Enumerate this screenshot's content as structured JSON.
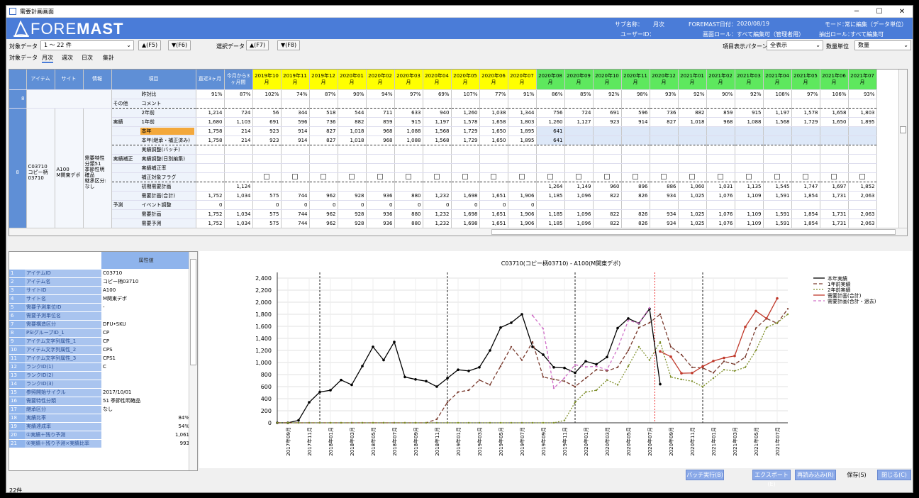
{
  "window": {
    "title": "需要計画画面",
    "min": "─",
    "max": "☐",
    "close": "✕"
  },
  "header": {
    "logo": "FOREMAST",
    "sub_label": "サブ名称：",
    "sub_value": "月次",
    "date_label": "FOREMAST日付：",
    "date_value": "2020/08/19",
    "mode_label": "モード：",
    "mode_value": "常に編集（データ単位）",
    "user_label": "ユーザーID：",
    "role_label": "画面ロール：",
    "role_value": "すべて編集可（管理者用）",
    "extract_label": "抽出ロール：",
    "extract_value": "すべて編集可"
  },
  "toolbar": {
    "target_label": "対象データ",
    "target_value": "1 〜 22 件",
    "up1": "▲(F5)",
    "down1": "▼(F6)",
    "select_label": "選択データ",
    "up2": "▲(F7)",
    "down2": "▼(F8)",
    "pattern_label": "項目表示パターン",
    "pattern_value": "全表示",
    "unit_label": "数量単位",
    "unit_value": "数量"
  },
  "tabs": {
    "lead": "対象データ",
    "items": [
      "月次",
      "週次",
      "日次",
      "集計"
    ]
  },
  "grid": {
    "headers": {
      "item": "アイテム",
      "site": "サイト",
      "info": "情報",
      "field": "項目",
      "recent3": "直近3ヶ月",
      "next3": "今月から3ヶ月間"
    },
    "months": [
      "2019年10月",
      "2019年11月",
      "2019年12月",
      "2020年01月",
      "2020年02月",
      "2020年03月",
      "2020年04月",
      "2020年05月",
      "2020年06月",
      "2020年07月",
      "2020年08月",
      "2020年09月",
      "2020年10月",
      "2020年11月",
      "2020年12月",
      "2021年01月",
      "2021年02月",
      "2021年03月",
      "2021年04月",
      "2021年05月",
      "2021年06月",
      "2021年07月"
    ],
    "row_num": "8",
    "item": "C03710\nコピー柄\n03710",
    "site": "A100\nM関東デポ",
    "info": "需要特性\n分類51\n季節性明\n確品\n継承区分:\nなし",
    "groups": {
      "other": "その他",
      "actual": "実績",
      "correction": "実績補正",
      "forecast": "予測"
    },
    "rows": [
      {
        "label": "昨対比",
        "r3": "91%",
        "n3": "87%",
        "v": [
          "102%",
          "74%",
          "87%",
          "90%",
          "94%",
          "97%",
          "69%",
          "107%",
          "77%",
          "91%",
          "86%",
          "85%",
          "92%",
          "98%",
          "93%",
          "92%",
          "90%",
          "92%",
          "108%",
          "97%",
          "106%",
          "93%"
        ]
      },
      {
        "label": "コメント",
        "r3": "",
        "n3": "",
        "v": [
          "",
          "",
          "",
          "",
          "",
          "",
          "",
          "",
          "",
          "",
          "",
          "",
          "",
          "",
          "",
          "",
          "",
          "",
          "",
          "",
          "",
          ""
        ]
      },
      {
        "label": "2年前",
        "r3": "1,214",
        "n3": "724",
        "v": [
          "56",
          "344",
          "518",
          "544",
          "711",
          "633",
          "940",
          "1,260",
          "1,038",
          "1,344",
          "756",
          "724",
          "691",
          "596",
          "736",
          "882",
          "859",
          "915",
          "1,197",
          "1,578",
          "1,658",
          "1,803"
        ]
      },
      {
        "label": "1年前",
        "r3": "1,680",
        "n3": "1,103",
        "v": [
          "691",
          "596",
          "736",
          "882",
          "859",
          "915",
          "1,197",
          "1,578",
          "1,658",
          "1,803",
          "1,260",
          "1,127",
          "923",
          "914",
          "827",
          "1,018",
          "968",
          "1,088",
          "1,568",
          "1,729",
          "1,650",
          "1,895"
        ]
      },
      {
        "label": "本年",
        "r3": "1,758",
        "n3": "214",
        "v": [
          "923",
          "914",
          "827",
          "1,018",
          "968",
          "1,088",
          "1,568",
          "1,729",
          "1,650",
          "1,895",
          "641",
          "",
          "",
          "",
          "",
          "",
          "",
          "",
          "",
          "",
          "",
          ""
        ]
      },
      {
        "label": "本年(継承・補正済み)",
        "r3": "1,758",
        "n3": "214",
        "v": [
          "923",
          "914",
          "827",
          "1,018",
          "968",
          "1,088",
          "1,568",
          "1,729",
          "1,650",
          "1,895",
          "641",
          "",
          "",
          "",
          "",
          "",
          "",
          "",
          "",
          "",
          "",
          ""
        ]
      },
      {
        "label": "実績調整(バッチ)",
        "r3": "",
        "n3": "",
        "v": [
          "",
          "",
          "",
          "",
          "",
          "",
          "",
          "",
          "",
          "",
          "",
          "",
          "",
          "",
          "",
          "",
          "",
          "",
          "",
          "",
          "",
          ""
        ]
      },
      {
        "label": "実績調整(日別編集)",
        "r3": "",
        "n3": "",
        "v": [
          "",
          "",
          "",
          "",
          "",
          "",
          "",
          "",
          "",
          "",
          "",
          "",
          "",
          "",
          "",
          "",
          "",
          "",
          "",
          "",
          "",
          ""
        ]
      },
      {
        "label": "実績補正率",
        "r3": "",
        "n3": "",
        "v": [
          "",
          "",
          "",
          "",
          "",
          "",
          "",
          "",
          "",
          "",
          "",
          "",
          "",
          "",
          "",
          "",
          "",
          "",
          "",
          "",
          "",
          ""
        ]
      },
      {
        "label": "補正対象フラグ",
        "r3": "",
        "n3": "",
        "v": [
          "☐",
          "☐",
          "☐",
          "☐",
          "☐",
          "☐",
          "☐",
          "☐",
          "☐",
          "☐",
          "☐",
          "☐",
          "☐",
          "☐",
          "☐",
          "☐",
          "☐",
          "☐",
          "☐",
          "☐",
          "☐",
          "☐"
        ]
      },
      {
        "label": "初期需要計画",
        "r3": "",
        "n3": "1,124",
        "v": [
          "",
          "",
          "",
          "",
          "",
          "",
          "",
          "",
          "",
          "",
          "1,264",
          "1,149",
          "960",
          "896",
          "886",
          "1,060",
          "1,031",
          "1,135",
          "1,545",
          "1,747",
          "1,697",
          "1,852"
        ]
      },
      {
        "label": "需要計画(合計)",
        "r3": "1,752",
        "n3": "1,034",
        "v": [
          "575",
          "744",
          "962",
          "928",
          "936",
          "880",
          "1,232",
          "1,698",
          "1,651",
          "1,906",
          "1,185",
          "1,096",
          "822",
          "826",
          "934",
          "1,025",
          "1,076",
          "1,109",
          "1,591",
          "1,854",
          "1,731",
          "2,063"
        ]
      },
      {
        "label": "イベント調整",
        "r3": "0",
        "n3": "",
        "v": [
          "0",
          "0",
          "0",
          "0",
          "0",
          "0",
          "0",
          "0",
          "0",
          "0",
          "",
          "",
          "",
          "",
          "",
          "",
          "",
          "",
          "",
          "",
          "",
          ""
        ]
      },
      {
        "label": "需要計画",
        "r3": "1,752",
        "n3": "1,034",
        "v": [
          "575",
          "744",
          "962",
          "928",
          "936",
          "880",
          "1,232",
          "1,698",
          "1,651",
          "1,906",
          "1,185",
          "1,096",
          "822",
          "826",
          "934",
          "1,025",
          "1,076",
          "1,109",
          "1,591",
          "1,854",
          "1,731",
          "2,063"
        ]
      },
      {
        "label": "需要予測",
        "r3": "1,752",
        "n3": "1,034",
        "v": [
          "575",
          "744",
          "962",
          "928",
          "936",
          "880",
          "1,232",
          "1,698",
          "1,651",
          "1,906",
          "1,185",
          "1,096",
          "822",
          "826",
          "934",
          "1,025",
          "1,076",
          "1,109",
          "1,591",
          "1,854",
          "1,731",
          "2,063"
        ]
      },
      {
        "label": "予測補正率",
        "r3": "",
        "n3": "",
        "v": [
          "",
          "",
          "",
          "",
          "",
          "",
          "",
          "",
          "",
          "",
          "",
          "",
          "",
          "",
          "",
          "",
          "",
          "",
          "",
          "",
          "",
          ""
        ]
      }
    ]
  },
  "attributes": {
    "header": "属性値",
    "rows": [
      {
        "n": "1",
        "k": "アイテムID",
        "v": "C03710"
      },
      {
        "n": "2",
        "k": "アイテム名",
        "v": "コピー柄03710"
      },
      {
        "n": "3",
        "k": "サイトID",
        "v": "A100"
      },
      {
        "n": "4",
        "k": "サイト名",
        "v": "M関東デポ"
      },
      {
        "n": "5",
        "k": "需要予測単位ID",
        "v": "-"
      },
      {
        "n": "6",
        "k": "需要予測単位名",
        "v": ""
      },
      {
        "n": "7",
        "k": "需要構造区分",
        "v": "DFU•SKU"
      },
      {
        "n": "8",
        "k": "PSIグループID_1",
        "v": "CP"
      },
      {
        "n": "9",
        "k": "アイテム文字列属性_1",
        "v": "CP"
      },
      {
        "n": "10",
        "k": "アイテム文字列属性_2",
        "v": "CPS"
      },
      {
        "n": "11",
        "k": "アイテム文字列属性_3",
        "v": "CPS1"
      },
      {
        "n": "12",
        "k": "ランクID(1)",
        "v": "C"
      },
      {
        "n": "13",
        "k": "ランクID(2)",
        "v": ""
      },
      {
        "n": "14",
        "k": "ランクID(3)",
        "v": ""
      },
      {
        "n": "15",
        "k": "参照開始サイクル",
        "v": "2017/10/01"
      },
      {
        "n": "16",
        "k": "需要特性分類",
        "v": "51 季節性明確品"
      },
      {
        "n": "17",
        "k": "継承区分",
        "v": "なし"
      },
      {
        "n": "18",
        "k": "実績比率",
        "v": "84%",
        "r": true
      },
      {
        "n": "19",
        "k": "実績達成率",
        "v": "54%",
        "r": true
      },
      {
        "n": "20",
        "k": "①実績＋残り予測",
        "v": "1,061",
        "r": true
      },
      {
        "n": "21",
        "k": "②実績＋残り予測×実績比率",
        "v": "993",
        "r": true
      }
    ]
  },
  "chart_data": {
    "type": "line",
    "title": "C03710(コピー柄03710) - A100(M関東デポ)",
    "ylim": [
      0,
      2400
    ],
    "yticks": [
      "0",
      "200",
      "400",
      "600",
      "800",
      "1,000",
      "1,200",
      "1,400",
      "1,600",
      "1,800",
      "2,000",
      "2,200",
      "2,400"
    ],
    "xlabels": [
      "2017年09月",
      "2017年11月",
      "2018年01月",
      "2018年03月",
      "2018年05月",
      "2018年07月",
      "2018年09月",
      "2018年11月",
      "2019年01月",
      "2019年03月",
      "2019年05月",
      "2019年07月",
      "2019年09月",
      "2019年11月",
      "2020年01月",
      "2020年03月",
      "2020年05月",
      "2020年07月",
      "2020年09月",
      "2020年11月",
      "2021年01月",
      "2021年03月",
      "2021年05月",
      "2021年07月"
    ],
    "series": [
      {
        "name": "本年実績",
        "color": "#000000",
        "dash": "",
        "start": 0,
        "values": [
          0,
          0,
          40,
          340,
          510,
          540,
          710,
          630,
          940,
          1260,
          1040,
          1340,
          760,
          720,
          690,
          600,
          740,
          880,
          860,
          920,
          1200,
          1580,
          1660,
          1800,
          1260,
          1130,
          920,
          910,
          830,
          1020,
          970,
          1090,
          1570,
          1730,
          1650,
          1890,
          640
        ]
      },
      {
        "name": "1年前実績",
        "color": "#7a3b2e",
        "dash": "5,3",
        "start": 0,
        "values": [
          0,
          0,
          0,
          0,
          0,
          0,
          0,
          0,
          0,
          0,
          0,
          0,
          0,
          0,
          0,
          60,
          340,
          510,
          540,
          710,
          630,
          940,
          1260,
          1040,
          1340,
          760,
          720,
          690,
          600,
          740,
          880,
          860,
          920,
          1200,
          1580,
          1660,
          1800,
          1260,
          1130,
          920,
          910,
          830,
          1020,
          970,
          1090,
          1570,
          1730,
          1650,
          1890
        ]
      },
      {
        "name": "2年前実績",
        "color": "#7f8f2a",
        "dash": "2,2",
        "start": 0,
        "values": [
          0,
          0,
          0,
          0,
          0,
          0,
          0,
          0,
          0,
          0,
          0,
          0,
          0,
          0,
          0,
          0,
          0,
          0,
          0,
          0,
          0,
          0,
          0,
          0,
          0,
          0,
          0,
          40,
          340,
          510,
          540,
          710,
          630,
          940,
          1260,
          1040,
          1340,
          760,
          720,
          690,
          600,
          740,
          880,
          860,
          920,
          1200,
          1580,
          1660,
          1800
        ]
      },
      {
        "name": "需要計画(合計)",
        "color": "#c0392b",
        "dash": "",
        "start": 36,
        "values": [
          1185,
          1096,
          822,
          826,
          934,
          1025,
          1076,
          1109,
          1591,
          1854,
          1731,
          2063
        ]
      },
      {
        "name": "需要計画(合計・過去)",
        "color": "#d070c8",
        "dash": "4,3",
        "start": 24,
        "values": [
          1780,
          1560,
          575,
          744,
          962,
          928,
          936,
          880,
          1232,
          1698,
          1651,
          1906
        ]
      }
    ]
  },
  "footer": {
    "batch": "バッチ実行(B)",
    "export": "エクスポート(E)",
    "reload": "再読み込み(R)",
    "save": "保存(S)",
    "close": "閉じる(C)",
    "count": "22件"
  }
}
